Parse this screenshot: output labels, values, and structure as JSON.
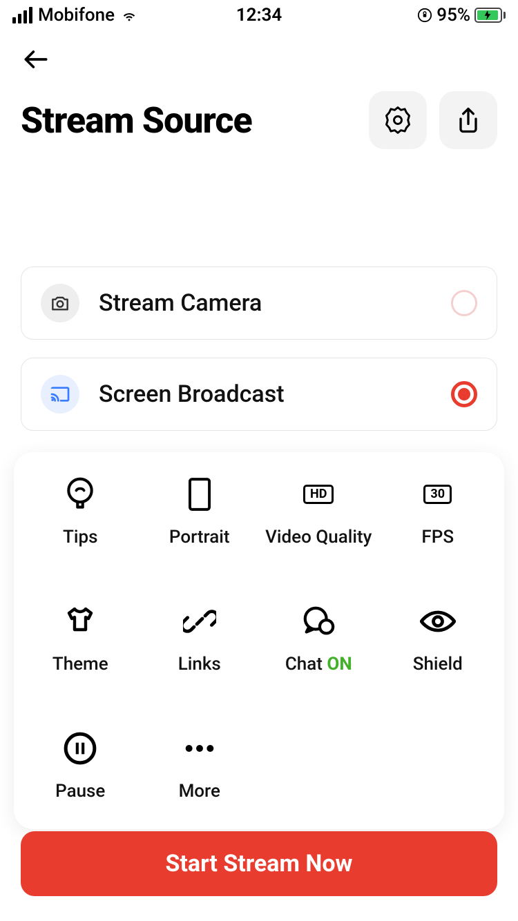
{
  "status_bar": {
    "carrier": "Mobifone",
    "time": "12:34",
    "battery_pct": "95%"
  },
  "header": {
    "title": "Stream Source"
  },
  "sources": {
    "camera": {
      "label": "Stream Camera",
      "selected": false
    },
    "screen": {
      "label": "Screen Broadcast",
      "selected": true
    }
  },
  "settings_grid": {
    "tips": {
      "label": "Tips"
    },
    "portrait": {
      "label": "Portrait"
    },
    "video_quality": {
      "label": "Video Quality",
      "badge": "HD"
    },
    "fps": {
      "label": "FPS",
      "badge": "30"
    },
    "theme": {
      "label": "Theme"
    },
    "links": {
      "label": "Links"
    },
    "chat": {
      "label_prefix": "Chat ",
      "status": "ON"
    },
    "shield": {
      "label": "Shield"
    },
    "pause": {
      "label": "Pause"
    },
    "more": {
      "label": "More"
    }
  },
  "start_button": {
    "label": "Start Stream Now"
  },
  "colors": {
    "accent_red": "#e83c2e",
    "chat_on_green": "#43b02a"
  }
}
